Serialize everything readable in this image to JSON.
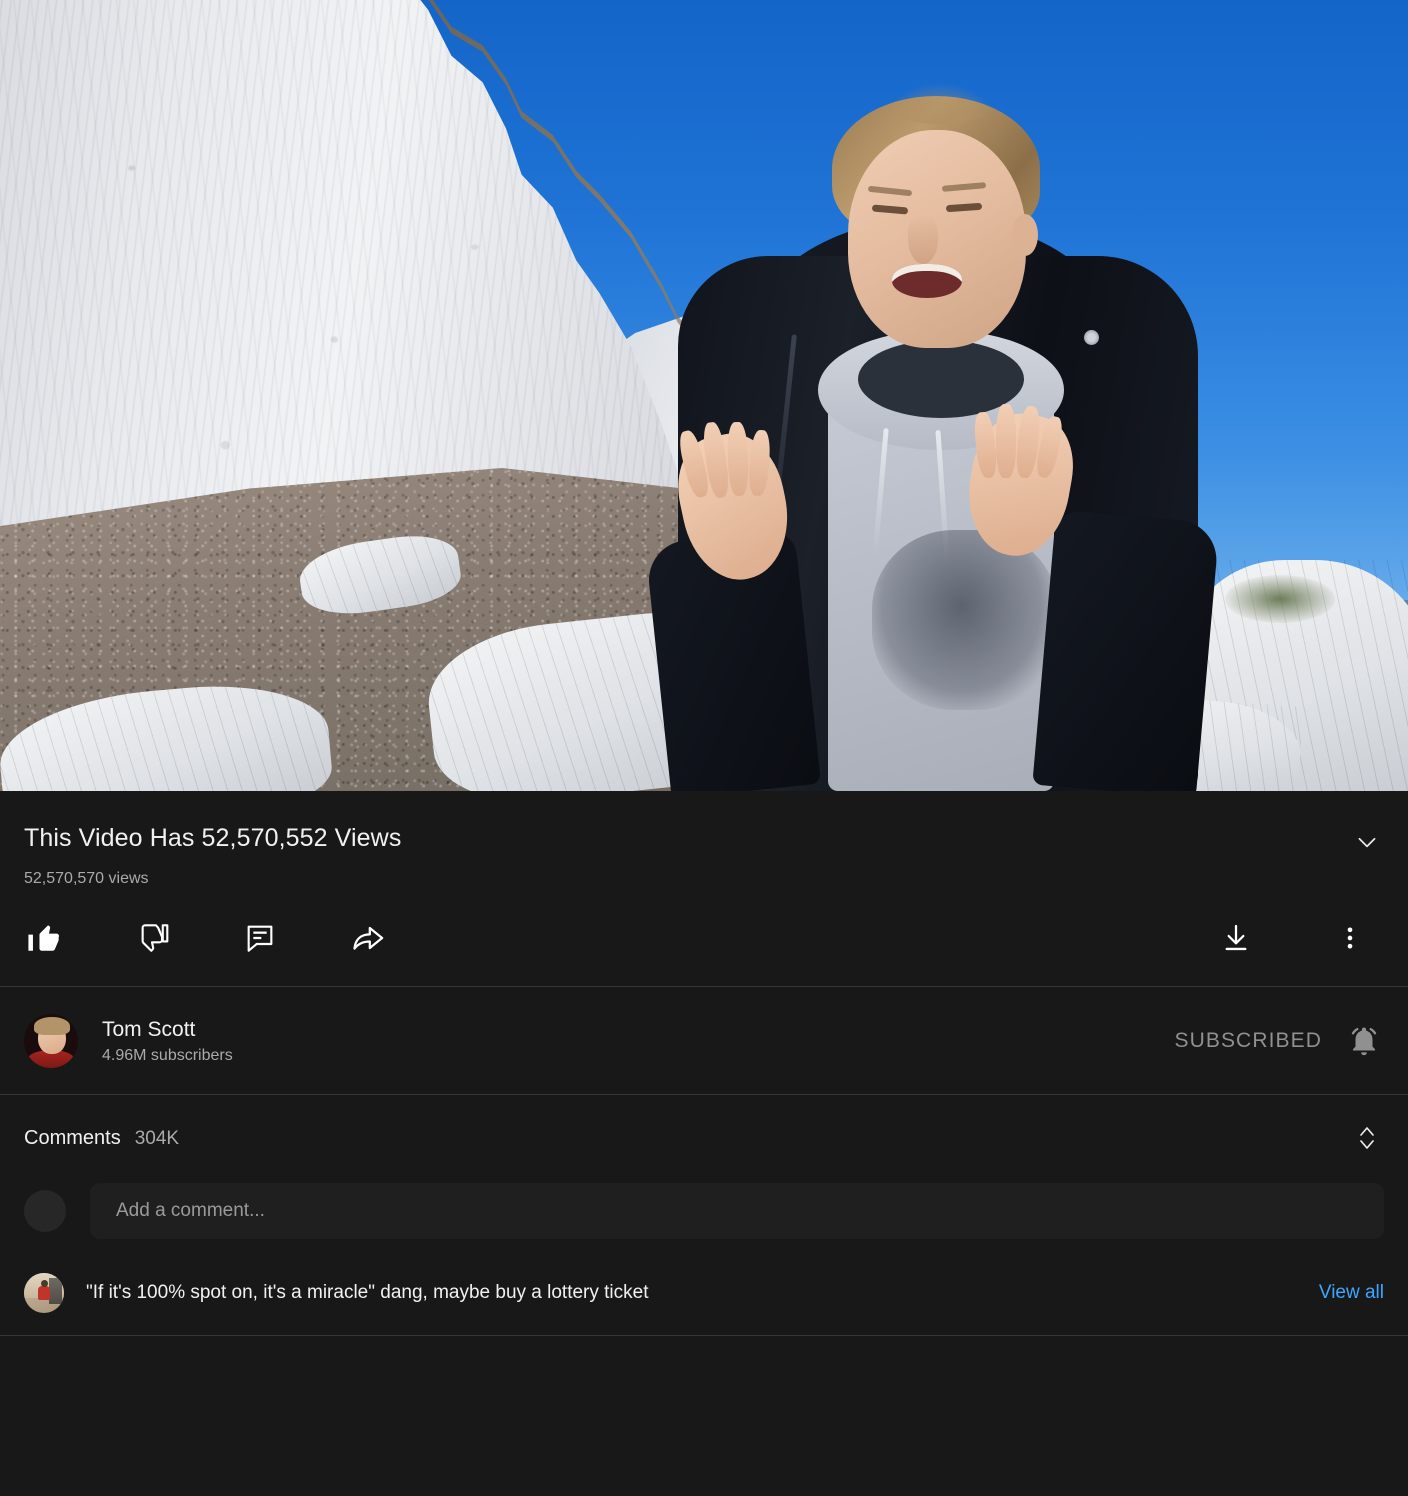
{
  "player": {
    "name": "video-player",
    "scene_description": "Man in black jacket and grey hoodie standing on a pebble beach below white chalk cliffs under a clear blue sky"
  },
  "video": {
    "title": "This Video Has 52,570,552 Views",
    "view_count": "52,570,570 views",
    "expand_icon": "chevron-down-icon"
  },
  "actions": {
    "like": {
      "label": "like-button",
      "icon": "thumbs-up-icon",
      "state": "active"
    },
    "dislike": {
      "label": "dislike-button",
      "icon": "thumbs-down-icon"
    },
    "comment": {
      "label": "comment-button",
      "icon": "comment-bubble-icon"
    },
    "share": {
      "label": "share-button",
      "icon": "share-arrow-icon"
    },
    "download": {
      "label": "download-button",
      "icon": "download-icon"
    },
    "more": {
      "label": "more-options-button",
      "icon": "three-dots-vertical-icon"
    }
  },
  "channel": {
    "name": "Tom Scott",
    "subscribers": "4.96M subscribers",
    "subscribe_label": "SUBSCRIBED",
    "notification_icon": "bell-ringing-icon",
    "avatar": "channel-avatar"
  },
  "comments": {
    "label": "Comments",
    "count": "304K",
    "sort_icon": "sort-up-down-icon",
    "add_placeholder": "Add a comment...",
    "top_comment": {
      "text": "\"If it's 100% spot on, it's a miracle\" dang, maybe buy a lottery ticket",
      "avatar": "commenter-avatar"
    },
    "view_all_label": "View all"
  },
  "colors": {
    "background": "#181818",
    "surface": "#1f1f1f",
    "divider": "#373737",
    "text_primary": "#f1f1f1",
    "text_secondary": "#aaaaaa",
    "link": "#3ea6ff",
    "subscribed": "#909090"
  }
}
